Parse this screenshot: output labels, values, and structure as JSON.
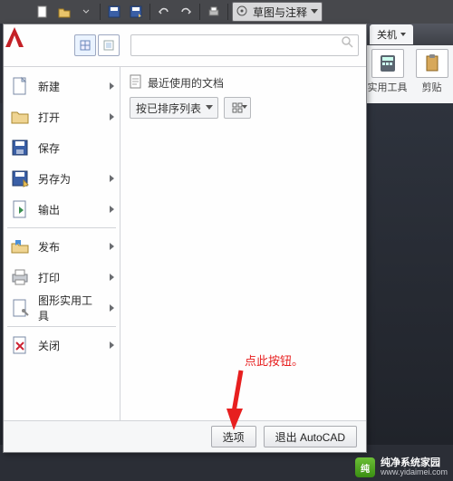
{
  "topbar": {
    "workspace": "草图与注释"
  },
  "ribbon": {
    "visible_tab": "关机",
    "items": [
      "实用工具",
      "剪贴"
    ]
  },
  "appmenu": {
    "search_placeholder": "",
    "recent_header": "最近使用的文档",
    "recent_sort": "按已排序列表",
    "items": [
      {
        "label": "新建",
        "has_submenu": true
      },
      {
        "label": "打开",
        "has_submenu": true
      },
      {
        "label": "保存",
        "has_submenu": false
      },
      {
        "label": "另存为",
        "has_submenu": true
      },
      {
        "label": "输出",
        "has_submenu": true
      },
      {
        "label": "发布",
        "has_submenu": true
      },
      {
        "label": "打印",
        "has_submenu": true
      },
      {
        "label": "图形实用工具",
        "has_submenu": true
      },
      {
        "label": "关闭",
        "has_submenu": true
      }
    ],
    "footer": {
      "options": "选项",
      "exit": "退出 AutoCAD"
    }
  },
  "annotation": {
    "text": "点此按钮。",
    "target": "options-button",
    "color": "#e71f1f"
  },
  "watermark": {
    "title": "纯净系统家园",
    "url": "www.yidaimei.com"
  }
}
